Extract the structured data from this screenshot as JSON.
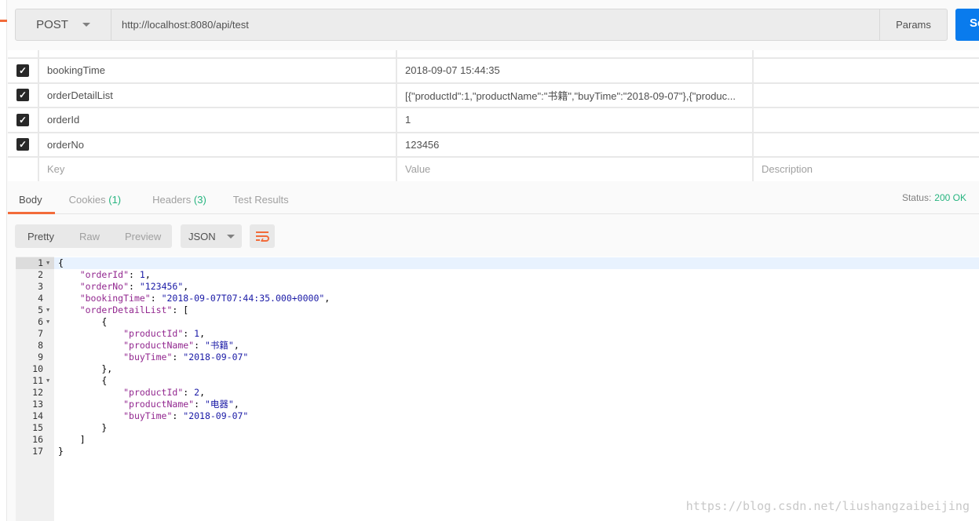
{
  "request": {
    "method": "POST",
    "url": "http://localhost:8080/api/test",
    "params_label": "Params",
    "send_label": "Send"
  },
  "body_params": [
    {
      "key": "bookingTime",
      "value": "2018-09-07 15:44:35",
      "checked": true
    },
    {
      "key": "orderDetailList",
      "value": "[{\"productId\":1,\"productName\":\"书籍\",\"buyTime\":\"2018-09-07\"},{\"produc...",
      "checked": true
    },
    {
      "key": "orderId",
      "value": "1",
      "checked": true
    },
    {
      "key": "orderNo",
      "value": "123456",
      "checked": true
    }
  ],
  "placeholders": {
    "key": "Key",
    "value": "Value",
    "description": "Description"
  },
  "response_tabs": {
    "body": "Body",
    "cookies": "Cookies",
    "cookies_count": "(1)",
    "headers": "Headers",
    "headers_count": "(3)",
    "tests": "Test Results"
  },
  "status": {
    "label": "Status:",
    "value": "200 OK"
  },
  "view_modes": {
    "pretty": "Pretty",
    "raw": "Raw",
    "preview": "Preview"
  },
  "format": "JSON",
  "code_lines": [
    {
      "n": "1",
      "fold": true,
      "t": [
        [
          "p",
          "{"
        ]
      ]
    },
    {
      "n": "2",
      "t": [
        [
          "p",
          "    "
        ],
        [
          "key",
          "\"orderId\""
        ],
        [
          "p",
          ": "
        ],
        [
          "numv",
          "1"
        ],
        [
          "p",
          ","
        ]
      ]
    },
    {
      "n": "3",
      "t": [
        [
          "p",
          "    "
        ],
        [
          "key",
          "\"orderNo\""
        ],
        [
          "p",
          ": "
        ],
        [
          "str",
          "\"123456\""
        ],
        [
          "p",
          ","
        ]
      ]
    },
    {
      "n": "4",
      "t": [
        [
          "p",
          "    "
        ],
        [
          "key",
          "\"bookingTime\""
        ],
        [
          "p",
          ": "
        ],
        [
          "str",
          "\"2018-09-07T07:44:35.000+0000\""
        ],
        [
          "p",
          ","
        ]
      ]
    },
    {
      "n": "5",
      "fold": true,
      "t": [
        [
          "p",
          "    "
        ],
        [
          "key",
          "\"orderDetailList\""
        ],
        [
          "p",
          ": ["
        ]
      ]
    },
    {
      "n": "6",
      "fold": true,
      "t": [
        [
          "p",
          "        {"
        ]
      ]
    },
    {
      "n": "7",
      "t": [
        [
          "p",
          "            "
        ],
        [
          "key",
          "\"productId\""
        ],
        [
          "p",
          ": "
        ],
        [
          "numv",
          "1"
        ],
        [
          "p",
          ","
        ]
      ]
    },
    {
      "n": "8",
      "t": [
        [
          "p",
          "            "
        ],
        [
          "key",
          "\"productName\""
        ],
        [
          "p",
          ": "
        ],
        [
          "str",
          "\"书籍\""
        ],
        [
          "p",
          ","
        ]
      ]
    },
    {
      "n": "9",
      "t": [
        [
          "p",
          "            "
        ],
        [
          "key",
          "\"buyTime\""
        ],
        [
          "p",
          ": "
        ],
        [
          "str",
          "\"2018-09-07\""
        ]
      ]
    },
    {
      "n": "10",
      "t": [
        [
          "p",
          "        },"
        ]
      ]
    },
    {
      "n": "11",
      "fold": true,
      "t": [
        [
          "p",
          "        {"
        ]
      ]
    },
    {
      "n": "12",
      "t": [
        [
          "p",
          "            "
        ],
        [
          "key",
          "\"productId\""
        ],
        [
          "p",
          ": "
        ],
        [
          "numv",
          "2"
        ],
        [
          "p",
          ","
        ]
      ]
    },
    {
      "n": "13",
      "t": [
        [
          "p",
          "            "
        ],
        [
          "key",
          "\"productName\""
        ],
        [
          "p",
          ": "
        ],
        [
          "str",
          "\"电器\""
        ],
        [
          "p",
          ","
        ]
      ]
    },
    {
      "n": "14",
      "t": [
        [
          "p",
          "            "
        ],
        [
          "key",
          "\"buyTime\""
        ],
        [
          "p",
          ": "
        ],
        [
          "str",
          "\"2018-09-07\""
        ]
      ]
    },
    {
      "n": "15",
      "t": [
        [
          "p",
          "        }"
        ]
      ]
    },
    {
      "n": "16",
      "t": [
        [
          "p",
          "    ]"
        ]
      ]
    },
    {
      "n": "17",
      "t": [
        [
          "p",
          "}"
        ]
      ]
    }
  ],
  "watermark": "https://blog.csdn.net/liushangzaibeijing"
}
